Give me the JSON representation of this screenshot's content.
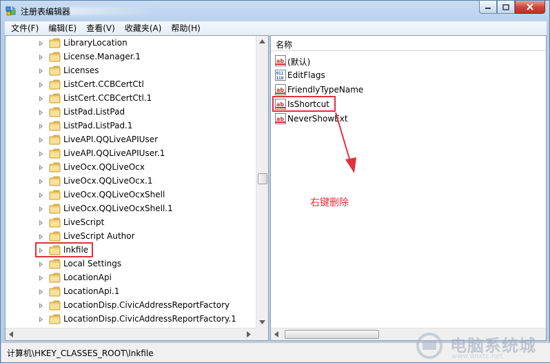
{
  "window": {
    "title": "注册表编辑器"
  },
  "menu": [
    "文件(F)",
    "编辑(E)",
    "查看(V)",
    "收藏夹(A)",
    "帮助(H)"
  ],
  "tree": {
    "items": [
      "LibraryLocation",
      "License.Manager.1",
      "Licenses",
      "ListCert.CCBCertCtl",
      "ListCert.CCBCertCtl.1",
      "ListPad.ListPad",
      "ListPad.ListPad.1",
      "LiveAPI.QQLiveAPIUser",
      "LiveAPI.QQLiveAPIUser.1",
      "LiveOcx.QQLiveOcx",
      "LiveOcx.QQLiveOcx.1",
      "LiveOcx.QQLiveOcxShell",
      "LiveOcx.QQLiveOcxShell.1",
      "LiveScript",
      "LiveScript Author",
      "lnkfile",
      "Local Settings",
      "LocationApi",
      "LocationApi.1",
      "LocationDisp.CivicAddressReportFactory",
      "LocationDisp.CivicAddressReportFactory.1"
    ],
    "selected": "lnkfile"
  },
  "values": {
    "column_name": "名称",
    "items": [
      {
        "name": "(默认)",
        "icon": "string-value-icon"
      },
      {
        "name": "EditFlags",
        "icon": "binary-value-icon"
      },
      {
        "name": "FriendlyTypeName",
        "icon": "string-value-icon"
      },
      {
        "name": "IsShortcut",
        "icon": "string-value-icon"
      },
      {
        "name": "NeverShowExt",
        "icon": "string-value-icon"
      }
    ]
  },
  "annotation": {
    "text": "右键删除",
    "color": "#e0303a"
  },
  "status": {
    "path": "计算机\\HKEY_CLASSES_ROOT\\lnkfile"
  },
  "watermark": {
    "text": "电脑系统城",
    "url": "www.dnxtc.net"
  }
}
